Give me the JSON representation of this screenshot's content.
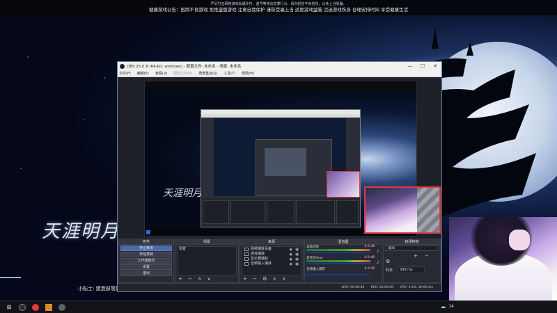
{
  "game": {
    "top_line1": "严厉打击网络游戏私服外挂、盗号等违法犯罪行为，请勿轻信不良信息，以免上当受骗。",
    "top_line2": "健康游戏公告：抵制不良游戏 拒绝盗版游戏 注意自我保护 谨防受骗上当 适度游戏益脑 沉迷游戏伤身 合理安排时间 享受健康生活",
    "logo": "天涯明月",
    "tip": "小贴士: 建造部落建"
  },
  "obs": {
    "title": "OBS 25.0.8 (64-bit, windows) - 配置文件: 未命名 - 场景: 未命名",
    "menu": [
      "文件(F)",
      "编辑(E)",
      "查看(V)",
      "配置文件(P)",
      "场景集合(S)",
      "工具(T)",
      "帮助(H)"
    ],
    "win_min": "—",
    "win_max": "☐",
    "win_close": "✕",
    "docks": {
      "controls": {
        "header": "控件",
        "buttons": [
          "停止推流",
          "开始录制",
          "工作室模式",
          "设置",
          "退出"
        ]
      },
      "scenes": {
        "header": "场景",
        "items": [
          "场景"
        ],
        "footer": "+ − ∧ ∨"
      },
      "sources": {
        "header": "来源",
        "items": [
          "视频捕获设备",
          "游戏捕获",
          "显示器捕获",
          "音频输入捕获"
        ],
        "footer": "+ − ⚙ ∧ ∨"
      },
      "mixer": {
        "header": "混音器",
        "channels": [
          {
            "name": "桌面音频",
            "db": "0.0 dB"
          },
          {
            "name": "麦克风/Aux",
            "db": "0.0 dB"
          },
          {
            "name": "音频输入捕获",
            "db": "0.0 dB"
          }
        ]
      },
      "transitions": {
        "header": "转场特效",
        "type": "淡出",
        "duration_label": "时长",
        "duration": "300 ms"
      }
    },
    "status": {
      "live": "LIVE: 00:00:00",
      "rec": "REC: 00:00:00",
      "cpu": "CPU: 2.2%, 30.00 fps"
    }
  },
  "taskbar": {
    "start_icon": "⊞",
    "temp": "14"
  },
  "colors": {
    "obs_bg": "#2b2e38",
    "accent": "#4c6aa8",
    "cam_border": "#e0393e"
  }
}
